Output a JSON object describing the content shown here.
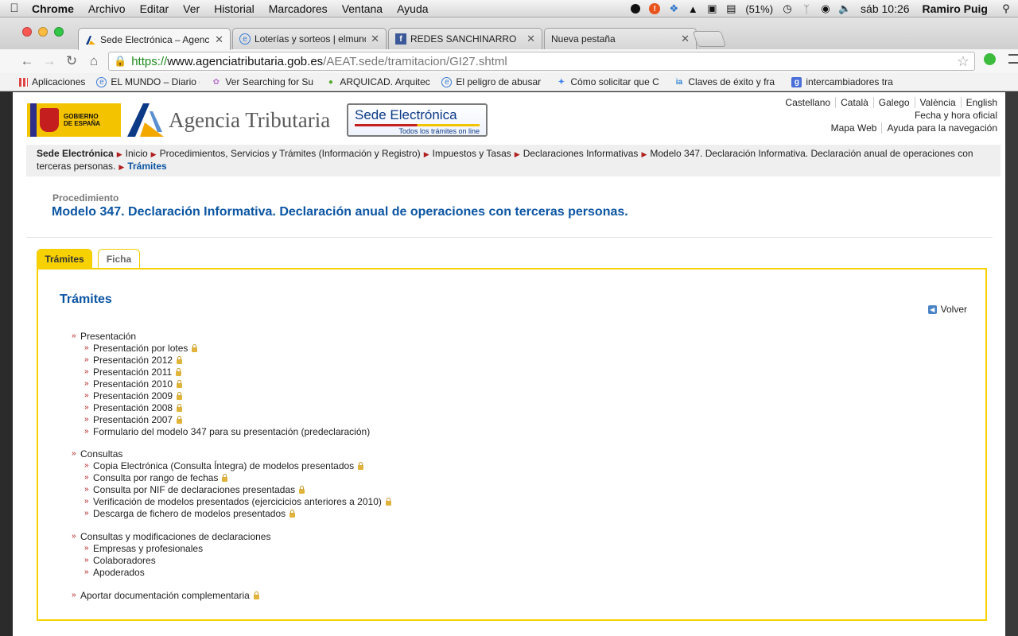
{
  "menubar": {
    "app": "Chrome",
    "menus": [
      "Archivo",
      "Editar",
      "Ver",
      "Historial",
      "Marcadores",
      "Ventana",
      "Ayuda"
    ],
    "battery": "(51%)",
    "clock": "sáb 10:26",
    "user": "Ramiro Puig"
  },
  "tabs": [
    {
      "title": "Sede Electrónica – Agencia",
      "icon": "aeat-favicon"
    },
    {
      "title": "Loterías y sorteos | elmund",
      "icon": "globe-favicon"
    },
    {
      "title": "REDES SANCHINARRO",
      "icon": "facebook-favicon"
    },
    {
      "title": "Nueva pestaña",
      "icon": ""
    }
  ],
  "omnibox": {
    "scheme": "https://",
    "host": "www.agenciatributaria.gob.es",
    "path": "/AEAT.sede/tramitacion/GI27.shtml"
  },
  "bookmarks": [
    {
      "label": "Aplicaciones",
      "icon": "apps-grid-icon",
      "color": "#d44"
    },
    {
      "label": "EL MUNDO – Diario c",
      "icon": "elmundo-favicon",
      "color": "#3a7bd5"
    },
    {
      "label": "Ver Searching for Su",
      "icon": "flower-icon",
      "color": "#b7c"
    },
    {
      "label": "ARQUICAD. Arquitec",
      "icon": "tree-icon",
      "color": "#5a3"
    },
    {
      "label": "El peligro de abusar",
      "icon": "globe-icon",
      "color": "#3a7bd5"
    },
    {
      "label": "Cómo solicitar que C",
      "icon": "google-icon",
      "color": "#4285f4"
    },
    {
      "label": "Claves de éxito y fra",
      "icon": "ia-icon",
      "color": "#2a7fd4"
    },
    {
      "label": "intercambiadores tra",
      "icon": "google-icon",
      "color": "#4a6fd8"
    }
  ],
  "header": {
    "gov_line1": "GOBIERNO",
    "gov_line2": "DE ESPAÑA",
    "agency": "Agencia Tributaria",
    "sede_title": "Sede Electrónica",
    "sede_sub": "Todos los trámites on line",
    "languages": [
      "Castellano",
      "Català",
      "Galego",
      "València",
      "English"
    ],
    "fecha": "Fecha y hora oficial",
    "links": [
      "Mapa Web",
      "Ayuda para la navegación"
    ]
  },
  "breadcrumb": [
    "Sede Electrónica",
    "Inicio",
    "Procedimientos, Servicios y Trámites (Información y Registro)",
    "Impuestos y Tasas",
    "Declaraciones Informativas",
    "Modelo 347. Declaración Informativa. Declaración anual de operaciones con terceras personas.",
    "Trámites"
  ],
  "procedure": {
    "label": "Procedimiento",
    "title": "Modelo 347. Declaración Informativa. Declaración anual de operaciones con terceras personas."
  },
  "page_tabs": {
    "tramites": "Trámites",
    "ficha": "Ficha"
  },
  "panel": {
    "title": "Trámites",
    "volver": "Volver",
    "groups": [
      {
        "head": "Presentación",
        "lock": false,
        "items": [
          {
            "label": "Presentación por lotes",
            "lock": true
          },
          {
            "label": "Presentación 2012",
            "lock": true
          },
          {
            "label": "Presentación 2011",
            "lock": true
          },
          {
            "label": "Presentación 2010",
            "lock": true
          },
          {
            "label": "Presentación 2009",
            "lock": true
          },
          {
            "label": "Presentación 2008",
            "lock": true
          },
          {
            "label": "Presentación 2007",
            "lock": true
          },
          {
            "label": "Formulario del modelo 347 para su presentación (predeclaración)",
            "lock": false
          }
        ]
      },
      {
        "head": "Consultas",
        "lock": false,
        "items": [
          {
            "label": "Copia Electrónica (Consulta Íntegra) de modelos presentados",
            "lock": true
          },
          {
            "label": "Consulta por rango de fechas",
            "lock": true
          },
          {
            "label": "Consulta por NIF de declaraciones presentadas",
            "lock": true
          },
          {
            "label": "Verificación de modelos presentados (ejercicicios anteriores a 2010)",
            "lock": true
          },
          {
            "label": "Descarga de fichero de modelos presentados",
            "lock": true
          }
        ]
      },
      {
        "head": "Consultas y modificaciones de declaraciones",
        "lock": false,
        "items": [
          {
            "label": "Empresas y profesionales",
            "lock": false
          },
          {
            "label": "Colaboradores",
            "lock": false
          },
          {
            "label": "Apoderados",
            "lock": false
          }
        ]
      },
      {
        "head": "Aportar documentación complementaria",
        "lock": true,
        "items": []
      }
    ]
  }
}
